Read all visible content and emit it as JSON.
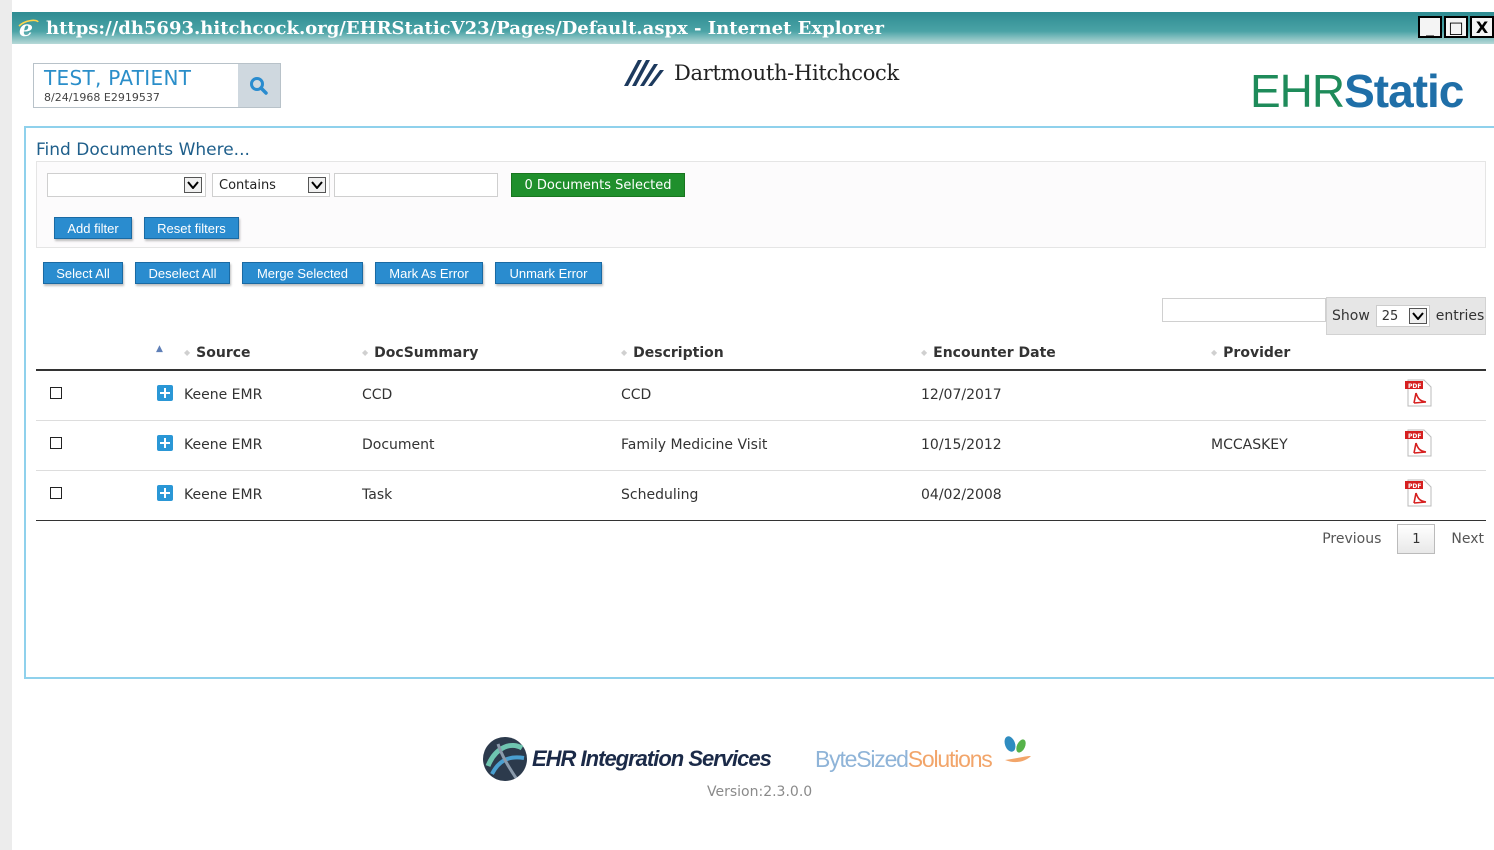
{
  "window": {
    "title": "https://dh5693.hitchcock.org/EHRStaticV23/Pages/Default.aspx - Internet Explorer",
    "minimize": "_",
    "maximize": "□",
    "close": "X"
  },
  "patient": {
    "name": "TEST, PATIENT",
    "dob": "8/24/1968",
    "mrn": "E2919537",
    "search_icon": "search-icon"
  },
  "brand": {
    "dh": "Dartmouth-Hitchcock",
    "ehr": "EHR",
    "static": "Static",
    "accent": "#2a8ccf"
  },
  "filters": {
    "heading": "Find Documents Where...",
    "field_value": "",
    "operator_value": "Contains",
    "text_value": "",
    "selected_badge": "0 Documents Selected",
    "add_filter": "Add filter",
    "reset_filters": "Reset filters"
  },
  "actions": {
    "select_all": "Select All",
    "deselect_all": "Deselect All",
    "merge_selected": "Merge Selected",
    "mark_error": "Mark As Error",
    "unmark_error": "Unmark Error"
  },
  "table_controls": {
    "search_value": "",
    "show_label": "Show",
    "page_length": "25",
    "entries_label": "entries"
  },
  "table": {
    "columns": [
      "Source",
      "DocSummary",
      "Description",
      "Encounter Date",
      "Provider"
    ],
    "rows": [
      {
        "source": "Keene EMR",
        "summary": "CCD",
        "description": "CCD",
        "date": "12/07/2017",
        "provider": ""
      },
      {
        "source": "Keene EMR",
        "summary": "Document",
        "description": "Family Medicine Visit",
        "date": "10/15/2012",
        "provider": "MCCASKEY"
      },
      {
        "source": "Keene EMR",
        "summary": "Task",
        "description": "Scheduling",
        "date": "04/02/2008",
        "provider": ""
      }
    ]
  },
  "pager": {
    "previous": "Previous",
    "page": "1",
    "next": "Next"
  },
  "footer": {
    "eis": "EHR Integration Services",
    "bss_a": "ByteSized",
    "bss_b": "Solutions",
    "version": "Version:2.3.0.0"
  }
}
